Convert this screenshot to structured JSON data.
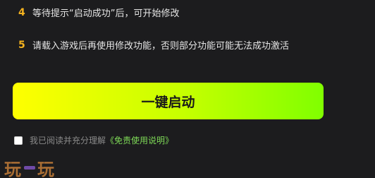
{
  "steps": [
    {
      "number": "4",
      "text": "等待提示“启动成功”后，可开始修改"
    },
    {
      "number": "5",
      "text": "请载入游戏后再使用修改功能，否则部分功能可能无法成功激活"
    }
  ],
  "launch_button": {
    "label": "一键启动"
  },
  "agreement": {
    "checked": false,
    "text": "我已阅读并充分理解",
    "link": "《免责使用说明》"
  },
  "watermark": {
    "text": "玩一玩"
  },
  "colors": {
    "background": "#1c1c1e",
    "step_number": "#f4b21f",
    "button_gradient_start": "#ffff00",
    "button_gradient_end": "#80ff00",
    "link": "#7ed957"
  }
}
